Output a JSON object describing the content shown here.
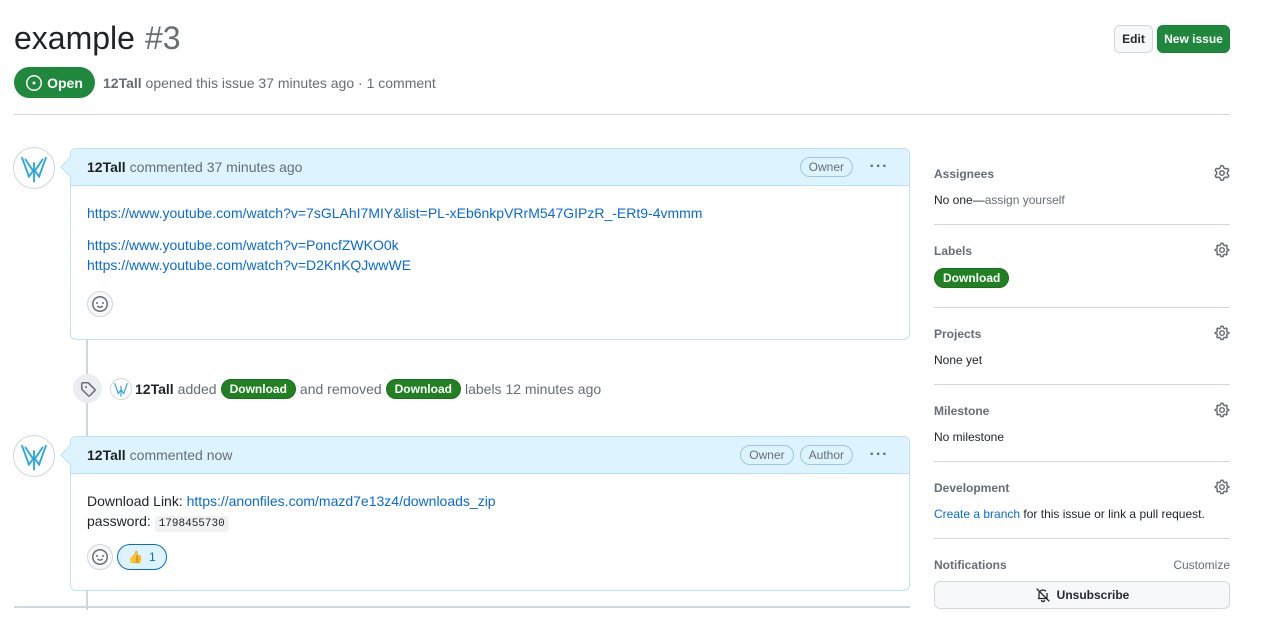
{
  "issue": {
    "title": "example",
    "number": "#3",
    "state": "Open",
    "author": "12Tall",
    "meta_suffix": " opened this issue 37 minutes ago · 1 comment"
  },
  "header_actions": {
    "edit_label": "Edit",
    "new_issue_label": "New issue"
  },
  "comments": [
    {
      "author": "12Tall",
      "time": "commented 37 minutes ago",
      "roles": [
        "Owner"
      ],
      "links": [
        "https://www.youtube.com/watch?v=7sGLAhI7MIY&list=PL-xEb6nkpVRrM547GIPzR_-ERt9-4vmmm",
        "https://www.youtube.com/watch?v=PoncfZWKO0k",
        "https://www.youtube.com/watch?v=D2KnKQJwwWE"
      ]
    },
    {
      "author": "12Tall",
      "time": "commented now",
      "roles": [
        "Owner",
        "Author"
      ],
      "download_prefix": "Download Link: ",
      "download_link": "https://anonfiles.com/mazd7e13z4/downloads_zip",
      "password_prefix": "password: ",
      "password": "1798455730",
      "reaction_count": "1"
    }
  ],
  "event": {
    "actor": "12Tall",
    "added": "added",
    "added_label": "Download",
    "removed": "and removed",
    "removed_label": "Download",
    "suffix": "labels 12 minutes ago"
  },
  "sidebar": {
    "assignees": {
      "title": "Assignees",
      "value_prefix": "No one—",
      "value_link": "assign yourself"
    },
    "labels": {
      "title": "Labels",
      "label": "Download",
      "label_color": "#218022"
    },
    "projects": {
      "title": "Projects",
      "value": "None yet"
    },
    "milestone": {
      "title": "Milestone",
      "value": "No milestone"
    },
    "development": {
      "title": "Development",
      "link": "Create a branch",
      "suffix": " for this issue or link a pull request."
    },
    "notifications": {
      "title": "Notifications",
      "customize": "Customize",
      "unsubscribe": "Unsubscribe"
    }
  },
  "colors": {
    "primary_green": "#1f883d",
    "link_blue": "#0969da",
    "comment_header": "#ddf4ff"
  },
  "icons": [
    "issue-opened-icon",
    "gear-icon",
    "kebab-icon",
    "smiley-icon",
    "tag-icon",
    "bell-slash-icon",
    "thumbs-up-icon"
  ]
}
